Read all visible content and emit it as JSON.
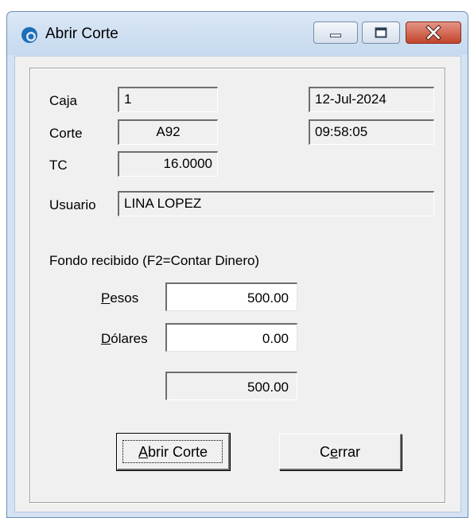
{
  "window": {
    "title": "Abrir Corte",
    "caption_buttons": [
      "minimize-icon",
      "maximize-icon",
      "close-icon"
    ]
  },
  "form": {
    "caja_label": "Caja",
    "caja_value": "1",
    "corte_label": "Corte",
    "corte_value": "A92",
    "tc_label": "TC",
    "tc_value": "16.0000",
    "date": "12-Jul-2024",
    "time": "09:58:05",
    "usuario_label": "Usuario",
    "usuario_value": "LINA LOPEZ",
    "fondo_label": "Fondo recibido  (F2=Contar Dinero)",
    "pesos_label_first": "P",
    "pesos_label_rest": "esos",
    "pesos_value": "500.00",
    "dolares_label_first": "D",
    "dolares_label_rest": "ólares",
    "dolares_value": "0.00",
    "total_value": "500.00"
  },
  "buttons": {
    "abrir_first": "A",
    "abrir_rest": "brir Corte",
    "cerrar_first": "C",
    "cerrar_mnemonic": "e",
    "cerrar_rest": "rrar"
  },
  "colors": {
    "titlebar": "#c6d9ef",
    "close_button": "#c2442c",
    "dialog_background": "#f0f0f0"
  }
}
